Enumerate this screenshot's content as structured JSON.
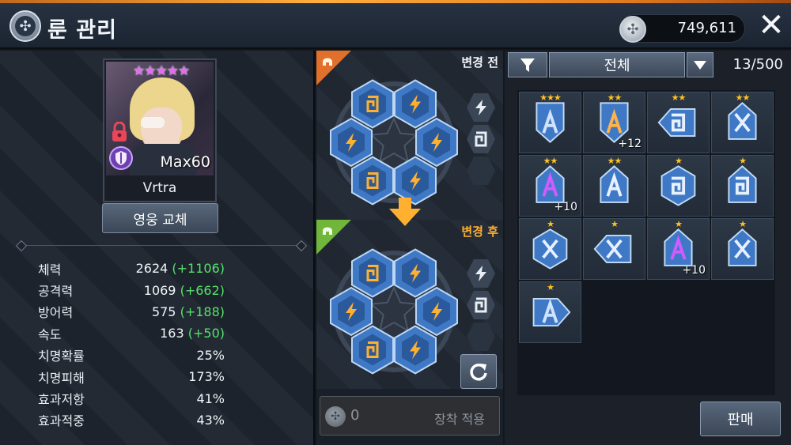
{
  "header": {
    "title": "룬 관리",
    "currency": "749,611",
    "close_glyph": "✕"
  },
  "hero": {
    "name": "Vrtra",
    "level": "Max60",
    "stars": "★★★★★",
    "swap_button": "영웅 교체"
  },
  "stats": [
    {
      "label": "체력",
      "value": "2624",
      "bonus": "(+1106)"
    },
    {
      "label": "공격력",
      "value": "1069",
      "bonus": "(+662)"
    },
    {
      "label": "방어력",
      "value": "575",
      "bonus": "(+188)"
    },
    {
      "label": "속도",
      "value": "163",
      "bonus": "(+50)"
    },
    {
      "label": "치명확률",
      "value": "25%",
      "bonus": ""
    },
    {
      "label": "치명피해",
      "value": "173%",
      "bonus": ""
    },
    {
      "label": "효과저항",
      "value": "41%",
      "bonus": ""
    },
    {
      "label": "효과적중",
      "value": "43%",
      "bonus": ""
    }
  ],
  "compare": {
    "before_label": "변경 전",
    "after_label": "변경 후",
    "before_slots": [
      "spiral",
      "bolt",
      "bolt",
      "bolt",
      "spiral",
      "bolt"
    ],
    "after_slots": [
      "spiral",
      "bolt",
      "bolt",
      "bolt",
      "spiral",
      "bolt"
    ],
    "sets": [
      "bolt-icon",
      "spiral-icon",
      "empty-set-slot"
    ],
    "apply_cost": "0",
    "apply_label": "장착 적용"
  },
  "inventory": {
    "filter_label": "전체",
    "count": "13/500",
    "sell_label": "판매",
    "items": [
      {
        "rune": "A",
        "stars": "★★★",
        "plus": "",
        "color": "#cfe3ff",
        "shape": "point-down"
      },
      {
        "rune": "A",
        "stars": "★★",
        "plus": "+12",
        "color": "#ffb14a",
        "shape": "point-down"
      },
      {
        "rune": "Ɔ",
        "stars": "★★",
        "plus": "",
        "color": "#e6f0ff",
        "shape": "point-left"
      },
      {
        "rune": "X",
        "stars": "★★",
        "plus": "",
        "color": "#e6f0ff",
        "shape": "point-up"
      },
      {
        "rune": "A",
        "stars": "★★",
        "plus": "+10",
        "color": "#d05cff",
        "shape": "point-up"
      },
      {
        "rune": "A",
        "stars": "★★",
        "plus": "",
        "color": "#e6f0ff",
        "shape": "point-up"
      },
      {
        "rune": "Ɔ",
        "stars": "★",
        "plus": "",
        "color": "#e6f0ff",
        "shape": "hex"
      },
      {
        "rune": "Ɔ",
        "stars": "★",
        "plus": "",
        "color": "#e6f0ff",
        "shape": "point-up"
      },
      {
        "rune": "X",
        "stars": "★",
        "plus": "",
        "color": "#e6f0ff",
        "shape": "hex"
      },
      {
        "rune": "X",
        "stars": "★",
        "plus": "",
        "color": "#e6f0ff",
        "shape": "point-left"
      },
      {
        "rune": "A",
        "stars": "★",
        "plus": "+10",
        "color": "#d05cff",
        "shape": "point-up"
      },
      {
        "rune": "X",
        "stars": "★",
        "plus": "",
        "color": "#e6f0ff",
        "shape": "point-up"
      },
      {
        "rune": "A",
        "stars": "★",
        "plus": "",
        "color": "#cfe3ff",
        "shape": "point-right"
      }
    ]
  },
  "colors": {
    "accent_orange": "#ffb030",
    "bonus_green": "#55e36a",
    "star_gold": "#ffc21f",
    "star_pink": "#e36cf2",
    "rune_blue": "#3f79c6"
  }
}
